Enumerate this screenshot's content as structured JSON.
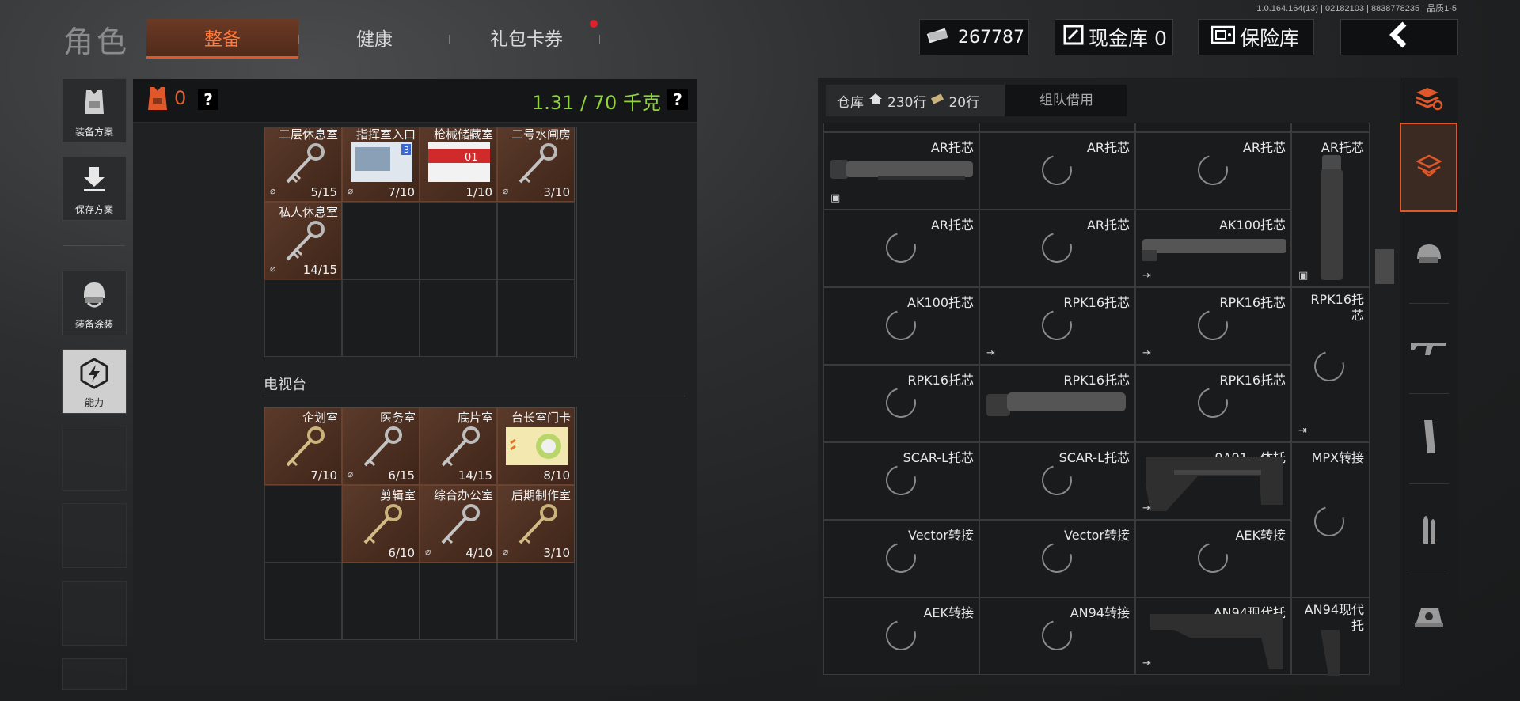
{
  "version": "1.0.164.164(13) | 02182103 | 8838778235 | 品质1-5",
  "title": "角色",
  "tabs": {
    "gear": "整备",
    "health": "健康",
    "gift": "礼包卡券"
  },
  "money": "267787",
  "cash_vault": "现金库 0",
  "insurance": "保险库",
  "sidebar": {
    "loadout": "装备方案",
    "save": "保存方案",
    "skin": "装备涂装",
    "ability": "能力"
  },
  "header": {
    "armor_count": "0",
    "weight": "1.31 / 70 千克",
    "help": "?"
  },
  "keys_top": [
    {
      "name": "二层休息室",
      "count": "5/15"
    },
    {
      "name": "指挥室入口",
      "count": "7/10",
      "badge": "3"
    },
    {
      "name": "枪械储藏室",
      "count": "1/10",
      "badge": "01"
    },
    {
      "name": "二号水闸房",
      "count": "3/10"
    },
    {
      "name": "私人休息室",
      "count": "14/15"
    }
  ],
  "section_tv": "电视台",
  "keys_tv": [
    {
      "name": "企划室",
      "count": "7/10"
    },
    {
      "name": "医务室",
      "count": "6/15"
    },
    {
      "name": "底片室",
      "count": "14/15"
    },
    {
      "name": "台长室门卡",
      "count": "8/10"
    },
    {
      "name": "剪辑室",
      "count": "6/10"
    },
    {
      "name": "综合办公室",
      "count": "4/10"
    },
    {
      "name": "后期制作室",
      "count": "3/10"
    }
  ],
  "warehouse": {
    "tab": "仓库",
    "rows_home": "230行",
    "rows_ticket": "20行",
    "team_tab": "组队借用"
  },
  "warehouse_items": [
    [
      "AR托芯",
      "AR托芯",
      "AR托芯",
      "AR托芯"
    ],
    [
      "AR托芯",
      "AR托芯",
      "AK100托芯",
      ""
    ],
    [
      "AK100托芯",
      "RPK16托芯",
      "RPK16托芯",
      "RPK16托芯"
    ],
    [
      "RPK16托芯",
      "RPK16托芯",
      "RPK16托芯",
      ""
    ],
    [
      "SCAR-L托芯",
      "SCAR-L托芯",
      "9A91一体托",
      "MPX转接"
    ],
    [
      "Vector转接",
      "Vector转接",
      "AEK转接",
      ""
    ],
    [
      "AEK转接",
      "AN94转接",
      "AN94现代托",
      "AN94现代托"
    ]
  ],
  "colors": {
    "accent": "#e0582a",
    "weight_ok": "#8fd33a"
  }
}
